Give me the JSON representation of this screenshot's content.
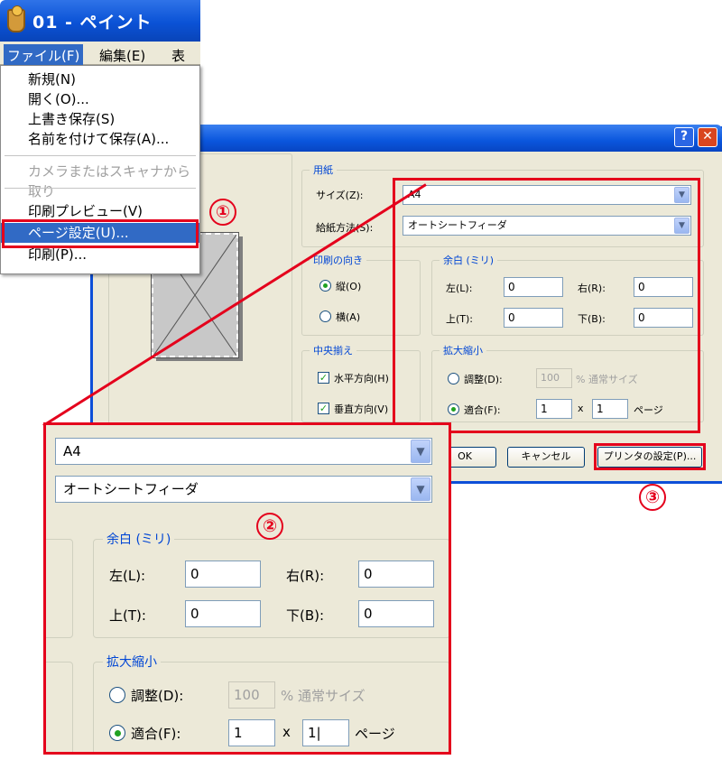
{
  "paint": {
    "title": "01 - ペイント",
    "menubar": [
      "ファイル(F)",
      "編集(E)",
      "表示"
    ],
    "file_menu": {
      "new": "新規(N)",
      "open": "開く(O)...",
      "save": "上書き保存(S)",
      "save_as": "名前を付けて保存(A)...",
      "scanner": "カメラまたはスキャナから取り",
      "print_preview": "印刷プレビュー(V)",
      "page_setup": "ページ設定(U)...",
      "print": "印刷(P)..."
    }
  },
  "dialog": {
    "paper_group": "用紙",
    "size_label": "サイズ(Z):",
    "size_value": "A4",
    "source_label": "給紙方法(S):",
    "source_value": "オートシートフィーダ",
    "orientation_group": "印刷の向き",
    "portrait": "縦(O)",
    "landscape": "横(A)",
    "margins_group": "余白 (ミリ)",
    "left_label": "左(L):",
    "left_value": "0",
    "right_label": "右(R):",
    "right_value": "0",
    "top_label": "上(T):",
    "top_value": "0",
    "bottom_label": "下(B):",
    "bottom_value": "0",
    "center_group": "中央揃え",
    "horizontal": "水平方向(H)",
    "vertical": "垂直方向(V)",
    "scale_group": "拡大縮小",
    "adjust_label": "調整(D):",
    "adjust_value": "100",
    "adjust_suffix": "% 通常サイズ",
    "fit_label": "適合(F):",
    "fit_w": "1",
    "fit_x": "x",
    "fit_h": "1",
    "fit_suffix": "ページ",
    "ok": "OK",
    "cancel": "キャンセル",
    "printer": "プリンタの設定(P)...",
    "help_btn": "?",
    "close_btn": "✕"
  },
  "zoom": {
    "size_value": "A4",
    "source_value": "オートシートフィーダ",
    "margins_group": "余白 (ミリ)",
    "left_label": "左(L):",
    "left_value": "0",
    "right_label": "右(R):",
    "right_value": "0",
    "top_label": "上(T):",
    "top_value": "0",
    "bottom_label": "下(B):",
    "bottom_value": "0",
    "scale_group": "拡大縮小",
    "adjust_label": "調整(D):",
    "adjust_value": "100",
    "adjust_suffix": "% 通常サイズ",
    "fit_label": "適合(F):",
    "fit_w": "1",
    "fit_x": "x",
    "fit_h": "1|",
    "fit_suffix": "ページ"
  },
  "callouts": {
    "one": "①",
    "two": "②",
    "three": "③"
  },
  "colors": {
    "highlight": "#e4001c",
    "xp_blue": "#0a52d6",
    "dialog_bg": "#ece9d8",
    "group_label": "#0046d5"
  },
  "icons": {
    "dropdown": "▼"
  }
}
